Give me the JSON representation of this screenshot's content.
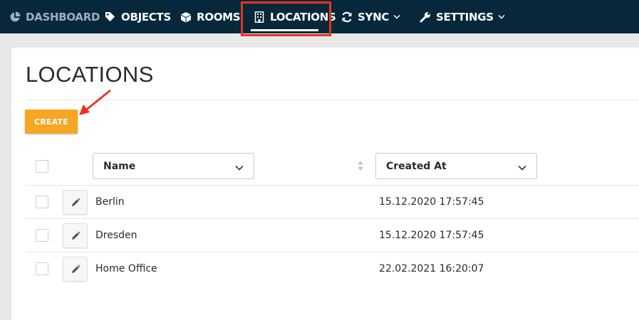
{
  "nav": {
    "dashboard": "DASHBOARD",
    "objects": "OBJECTS",
    "rooms": "ROOMS",
    "locations": "LOCATIONS",
    "sync": "SYNC",
    "settings": "SETTINGS"
  },
  "page": {
    "title": "LOCATIONS",
    "create_label": "CREATE"
  },
  "table": {
    "columns": [
      {
        "label": "Name"
      },
      {
        "label": "Created At"
      }
    ],
    "rows": [
      {
        "name": "Berlin",
        "created_at": "15.12.2020 17:57:45"
      },
      {
        "name": "Dresden",
        "created_at": "15.12.2020 17:57:45"
      },
      {
        "name": "Home Office",
        "created_at": "22.02.2021 16:20:07"
      }
    ]
  },
  "colors": {
    "nav_bg": "#06283a",
    "accent": "#f5a623",
    "highlight": "#e8321e"
  },
  "icons": {
    "dashboard": "pie-chart-icon",
    "objects": "tag-icon",
    "rooms": "cube-icon",
    "locations": "building-icon",
    "sync": "sync-icon",
    "settings": "wrench-icon",
    "edit": "pencil-icon"
  }
}
